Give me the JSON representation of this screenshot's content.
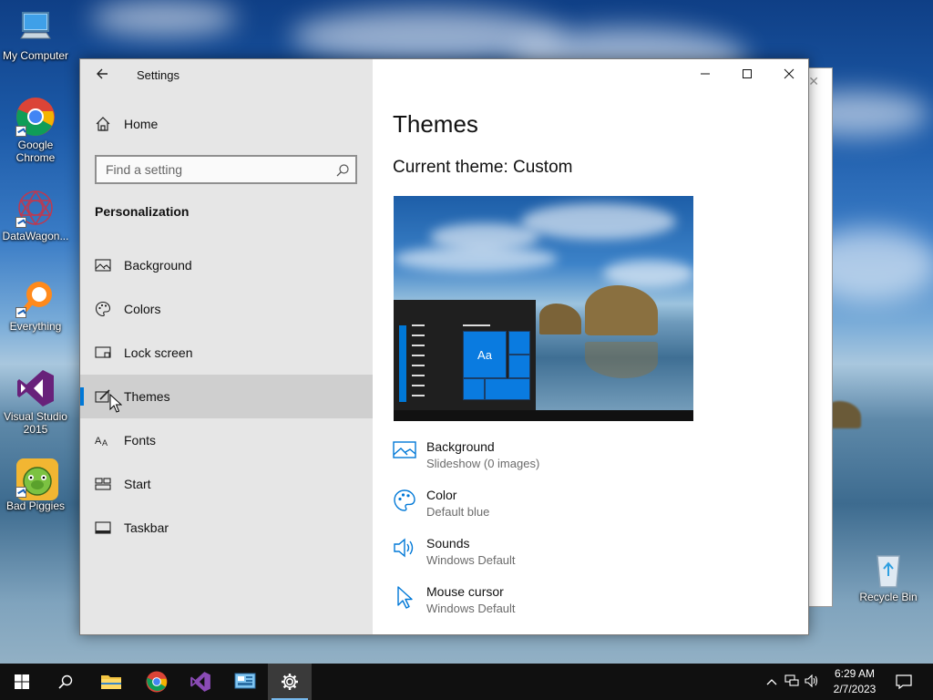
{
  "desktop": {
    "icons": [
      {
        "label": "My Computer",
        "icon": "computer-icon"
      },
      {
        "label": "Google Chrome",
        "icon": "chrome-icon"
      },
      {
        "label": "DataWagon...",
        "icon": "datawagon-icon"
      },
      {
        "label": "Everything",
        "icon": "everything-search-icon"
      },
      {
        "label": "Visual Studio 2015",
        "icon": "visual-studio-icon"
      },
      {
        "label": "Bad Piggies",
        "icon": "bad-piggies-icon"
      },
      {
        "label": "Recycle Bin",
        "icon": "recycle-bin-icon"
      }
    ]
  },
  "settings": {
    "title": "Settings",
    "home_label": "Home",
    "search_placeholder": "Find a setting",
    "section": "Personalization",
    "nav": [
      {
        "label": "Background",
        "icon": "picture-icon"
      },
      {
        "label": "Colors",
        "icon": "palette-icon"
      },
      {
        "label": "Lock screen",
        "icon": "lock-screen-icon"
      },
      {
        "label": "Themes",
        "icon": "themes-brush-icon",
        "selected": true
      },
      {
        "label": "Fonts",
        "icon": "fonts-icon"
      },
      {
        "label": "Start",
        "icon": "start-tiles-icon"
      },
      {
        "label": "Taskbar",
        "icon": "taskbar-icon"
      }
    ],
    "page_title": "Themes",
    "current_theme": "Current theme: Custom",
    "preview_tile_text": "Aa",
    "theme_items": [
      {
        "title": "Background",
        "value": "Slideshow (0 images)",
        "icon": "picture-icon"
      },
      {
        "title": "Color",
        "value": "Default blue",
        "icon": "palette-icon"
      },
      {
        "title": "Sounds",
        "value": "Windows Default",
        "icon": "speaker-icon"
      },
      {
        "title": "Mouse cursor",
        "value": "Windows Default",
        "icon": "cursor-icon"
      }
    ]
  },
  "taskbar": {
    "time": "6:29 AM",
    "date": "2/7/2023",
    "apps": [
      "start-icon",
      "search-icon",
      "file-explorer-icon",
      "chrome-icon",
      "visual-studio-icon",
      "control-panel-icon",
      "settings-gear-icon"
    ]
  },
  "colors": {
    "accent": "#0078d7",
    "pane_left": "#e6e6e6",
    "taskbar": "#101010"
  }
}
